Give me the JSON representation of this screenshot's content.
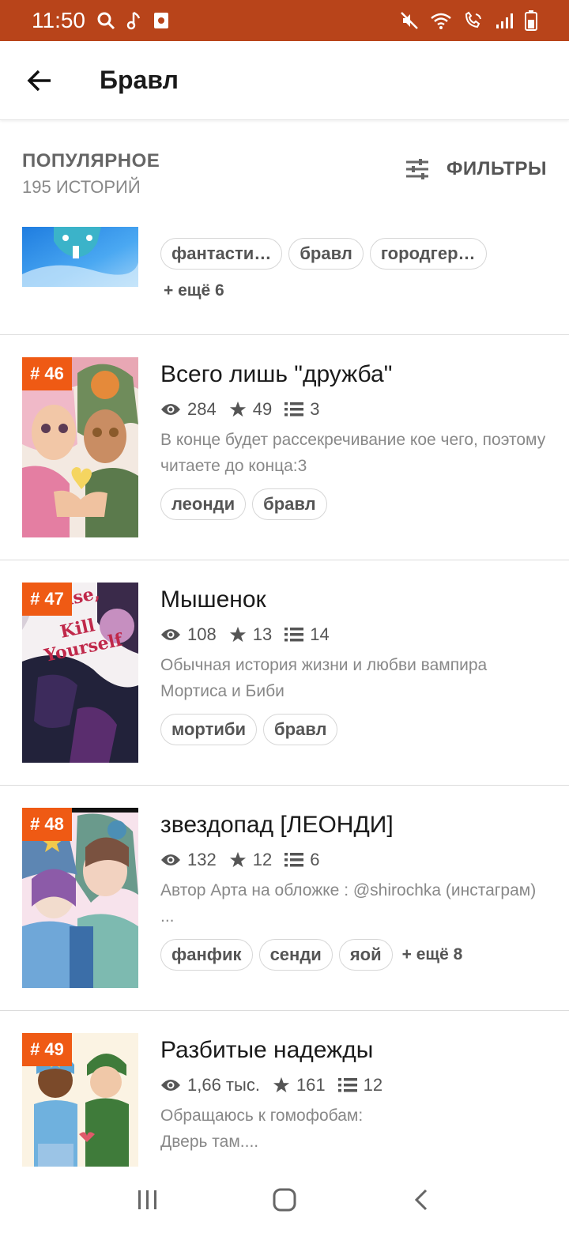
{
  "status_bar": {
    "time": "11:50",
    "icons": [
      "search-icon",
      "music-note-icon",
      "screenshot-icon",
      "mute-icon",
      "wifi-icon",
      "wifi-call-icon",
      "signal-icon",
      "battery-icon"
    ]
  },
  "app_bar": {
    "title": "Бравл",
    "back_icon": "arrow-back-icon"
  },
  "list_header": {
    "title": "ПОПУЛЯРНОЕ",
    "subtitle": "195 ИСТОРИЙ",
    "filters_label": "ФИЛЬТРЫ",
    "filters_icon": "sliders-icon"
  },
  "partial_story": {
    "tags": [
      "фантасти…",
      "бравл",
      "городгер…"
    ],
    "more": "+ ещё 6"
  },
  "stories": [
    {
      "rank": "# 46",
      "title": "Всего лишь \"дружба\"",
      "views": "284",
      "stars": "49",
      "parts": "3",
      "description": "В конце будет рассекречивание кое чего, поэтому читаете до конца:3",
      "tags": [
        "леонди",
        "бравл"
      ],
      "more": ""
    },
    {
      "rank": "# 47",
      "title": "Мышенок",
      "views": "108",
      "stars": "13",
      "parts": "14",
      "description": "Обычная история жизни и любви вампира Мортиса и Биби",
      "tags": [
        "мортиби",
        "бравл"
      ],
      "more": "",
      "cover_text": "Please, Kill Yourself"
    },
    {
      "rank": "# 48",
      "title": "звездопад [ЛЕОНДИ]",
      "views": "132",
      "stars": "12",
      "parts": "6",
      "description": "Автор Арта на обложке : @shirochka (инстаграм) ...",
      "tags": [
        "фанфик",
        "сенди",
        "яой"
      ],
      "more": "+ ещё 8"
    },
    {
      "rank": "# 49",
      "title": "Разбитые надежды",
      "views": "1,66 тыс.",
      "stars": "161",
      "parts": "12",
      "description": "Обращаюсь к гомофобам: Дверь там....",
      "tags": [],
      "more": ""
    }
  ],
  "nav_bar": {
    "icons": [
      "recent-apps-icon",
      "home-icon",
      "back-icon"
    ]
  },
  "colors": {
    "status_bar": "#b8441a",
    "rank_badge": "#ef5a14"
  }
}
